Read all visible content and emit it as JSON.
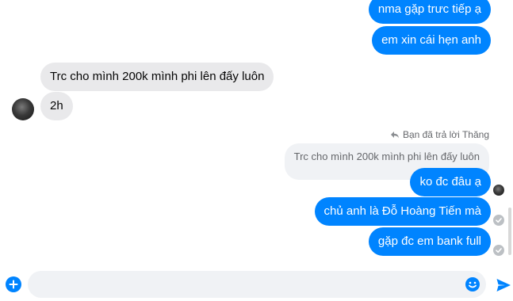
{
  "colors": {
    "outgoing_bubble": "#0084ff",
    "incoming_bubble": "#e9e9eb",
    "quoted_bubble": "#f0f2f5",
    "secondary_text": "#65676b"
  },
  "messages": {
    "out_1": "nma gặp trưc tiếp ạ",
    "out_2": "em xin cái hẹn anh",
    "in_1": "Trc cho mình 200k mình phi lên đấy luôn",
    "in_2": "2h",
    "reply_note": "Bạn đã trả lời Thăng",
    "quoted": "Trc cho mình 200k mình phi lên đấy luôn",
    "out_3": "ko đc đâu ạ",
    "out_4": "chủ anh là Đỗ Hoàng Tiến mà",
    "out_5": "gặp đc em bank full"
  },
  "icons": {
    "reply": "reply-arrow-icon",
    "seen": "seen-check-icon",
    "add": "plus-icon",
    "emoji": "smiley-icon",
    "send": "send-icon"
  },
  "composer": {
    "placeholder": "",
    "value": ""
  }
}
